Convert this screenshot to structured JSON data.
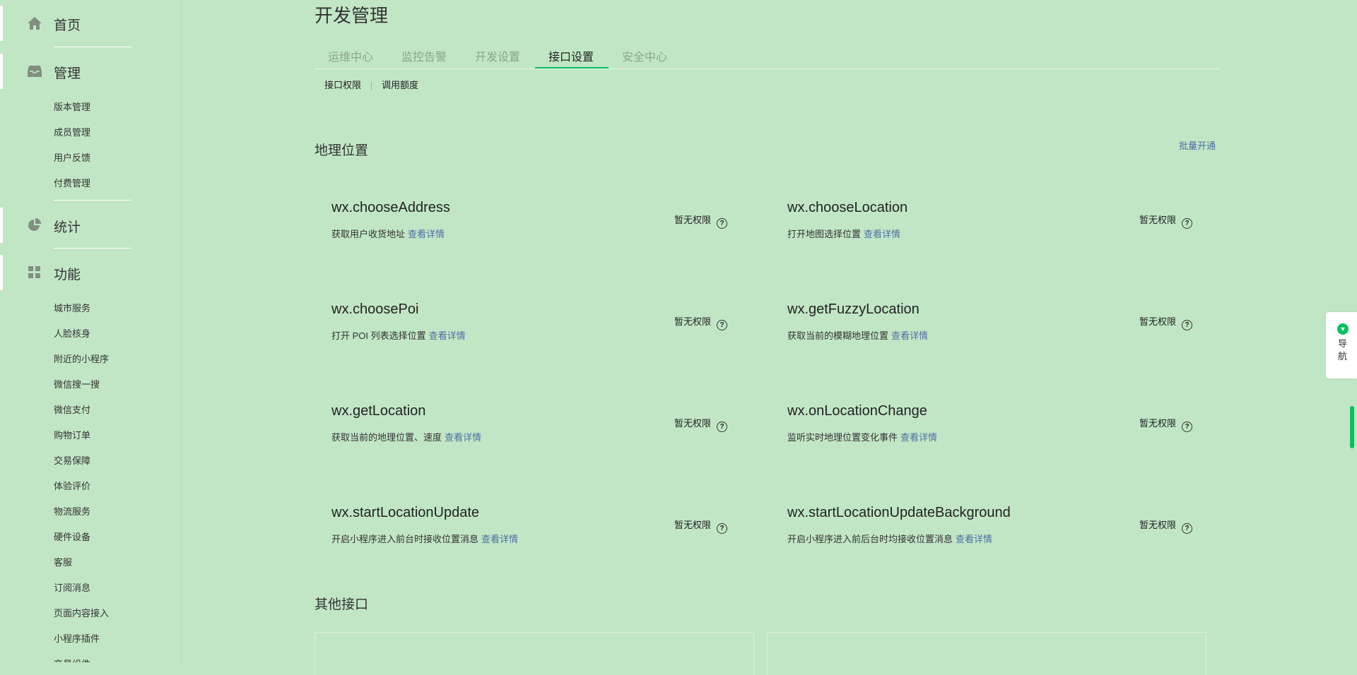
{
  "sidebar": {
    "home": {
      "label": "首页",
      "icon": "home-icon"
    },
    "manage": {
      "label": "管理",
      "icon": "inbox-icon",
      "items": [
        "版本管理",
        "成员管理",
        "用户反馈",
        "付费管理"
      ]
    },
    "stats": {
      "label": "统计",
      "icon": "pie-chart-icon"
    },
    "features": {
      "label": "功能",
      "icon": "grid-icon",
      "items": [
        "城市服务",
        "人脸核身",
        "附近的小程序",
        "微信搜一搜",
        "微信支付",
        "购物订单",
        "交易保障",
        "体验评价",
        "物流服务",
        "硬件设备",
        "客服",
        "订阅消息",
        "页面内容接入",
        "小程序插件",
        "交易组件"
      ]
    }
  },
  "page_title": "开发管理",
  "tabs": [
    "运维中心",
    "监控告警",
    "开发设置",
    "接口设置",
    "安全中心"
  ],
  "active_tab": "接口设置",
  "subtabs": [
    "接口权限",
    "调用额度"
  ],
  "section_geo": {
    "title": "地理位置",
    "batch_label": "批量开通",
    "detail_label": "查看详情",
    "perm_label": "暂无权限",
    "apis": [
      {
        "name": "wx.chooseAddress",
        "desc": "获取用户收货地址"
      },
      {
        "name": "wx.chooseLocation",
        "desc": "打开地图选择位置"
      },
      {
        "name": "wx.choosePoi",
        "desc": "打开 POI 列表选择位置"
      },
      {
        "name": "wx.getFuzzyLocation",
        "desc": "获取当前的模糊地理位置"
      },
      {
        "name": "wx.getLocation",
        "desc": "获取当前的地理位置、速度"
      },
      {
        "name": "wx.onLocationChange",
        "desc": "监听实时地理位置变化事件"
      },
      {
        "name": "wx.startLocationUpdate",
        "desc": "开启小程序进入前台时接收位置消息"
      },
      {
        "name": "wx.startLocationUpdateBackground",
        "desc": "开启小程序进入前后台时均接收位置消息"
      }
    ]
  },
  "section_other": {
    "title": "其他接口"
  },
  "float_nav": {
    "label": "导航"
  },
  "colors": {
    "background": "#c1e6c5",
    "accent": "#07c160",
    "link": "#4e6ea6"
  }
}
